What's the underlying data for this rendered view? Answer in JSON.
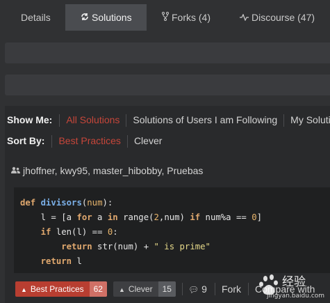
{
  "tabs": [
    {
      "label": "Details",
      "icon": "none"
    },
    {
      "label": "Solutions",
      "icon": "solutions-icon"
    },
    {
      "label": "Forks (4)",
      "icon": "fork-icon"
    },
    {
      "label": "Discourse (47)",
      "icon": "discourse-icon"
    }
  ],
  "filters": {
    "show_me": {
      "label": "Show Me:",
      "options": [
        "All Solutions",
        "Solutions of Users I am Following",
        "My Solutions"
      ],
      "selected": "All Solutions"
    },
    "sort_by": {
      "label": "Sort By:",
      "options": [
        "Best Practices",
        "Clever"
      ],
      "selected": "Best Practices"
    }
  },
  "solution": {
    "authors": "jhoffner, kwy95, master_hibobby, Pruebas",
    "code_lines": [
      "def divisors(num):",
      "    l = [a for a in range(2,num) if num%a == 0]",
      "    if len(l) == 0:",
      "        return str(num) + \" is prime\"",
      "    return l"
    ],
    "actions": {
      "best_practices_label": "Best Practices",
      "best_practices_count": "62",
      "clever_label": "Clever",
      "clever_count": "15",
      "comments_count": "9",
      "fork_label": "Fork",
      "compare_label": "Compare with"
    }
  },
  "watermark": {
    "text": "经验",
    "subtext": "jingyan.baidu.com"
  },
  "colors": {
    "accent": "#c6463a",
    "background": "#303133",
    "panel": "#292a2c",
    "code_bg": "#1f2021"
  }
}
